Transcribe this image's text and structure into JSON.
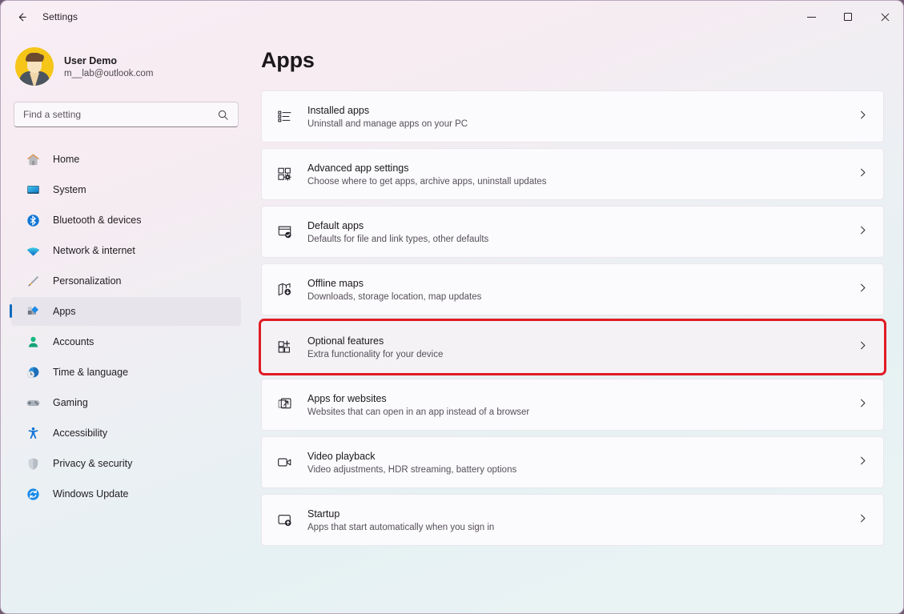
{
  "window": {
    "title": "Settings",
    "back_icon": "back-arrow-icon",
    "controls": {
      "minimize": "minimize-icon",
      "maximize": "maximize-icon",
      "close": "close-icon"
    }
  },
  "sidebar": {
    "profile": {
      "name": "User Demo",
      "email": "m__lab@outlook.com",
      "avatar_icon": "user-avatar"
    },
    "search": {
      "placeholder": "Find a setting",
      "value": "",
      "icon": "search-icon"
    },
    "items": [
      {
        "label": "Home",
        "icon": "home-icon",
        "selected": false
      },
      {
        "label": "System",
        "icon": "system-icon",
        "selected": false
      },
      {
        "label": "Bluetooth & devices",
        "icon": "bluetooth-icon",
        "selected": false
      },
      {
        "label": "Network & internet",
        "icon": "wifi-icon",
        "selected": false
      },
      {
        "label": "Personalization",
        "icon": "brush-icon",
        "selected": false
      },
      {
        "label": "Apps",
        "icon": "apps-icon",
        "selected": true
      },
      {
        "label": "Accounts",
        "icon": "account-icon",
        "selected": false
      },
      {
        "label": "Time & language",
        "icon": "clock-globe-icon",
        "selected": false
      },
      {
        "label": "Gaming",
        "icon": "gamepad-icon",
        "selected": false
      },
      {
        "label": "Accessibility",
        "icon": "accessibility-icon",
        "selected": false
      },
      {
        "label": "Privacy & security",
        "icon": "shield-icon",
        "selected": false
      },
      {
        "label": "Windows Update",
        "icon": "update-icon",
        "selected": false
      }
    ]
  },
  "main": {
    "page_title": "Apps",
    "cards": [
      {
        "title": "Installed apps",
        "subtitle": "Uninstall and manage apps on your PC",
        "icon": "list-icon",
        "highlighted": false
      },
      {
        "title": "Advanced app settings",
        "subtitle": "Choose where to get apps, archive apps, uninstall updates",
        "icon": "app-settings-icon",
        "highlighted": false
      },
      {
        "title": "Default apps",
        "subtitle": "Defaults for file and link types, other defaults",
        "icon": "default-apps-icon",
        "highlighted": false
      },
      {
        "title": "Offline maps",
        "subtitle": "Downloads, storage location, map updates",
        "icon": "map-download-icon",
        "highlighted": false
      },
      {
        "title": "Optional features",
        "subtitle": "Extra functionality for your device",
        "icon": "optional-features-icon",
        "highlighted": true
      },
      {
        "title": "Apps for websites",
        "subtitle": "Websites that can open in an app instead of a browser",
        "icon": "external-link-icon",
        "highlighted": false
      },
      {
        "title": "Video playback",
        "subtitle": "Video adjustments, HDR streaming, battery options",
        "icon": "video-icon",
        "highlighted": false
      },
      {
        "title": "Startup",
        "subtitle": "Apps that start automatically when you sign in",
        "icon": "startup-icon",
        "highlighted": false
      }
    ],
    "chevron_icon": "chevron-right-icon"
  },
  "colors": {
    "accent": "#0f6cbd",
    "highlight": "#e01b24",
    "card_bg": "#fbfafc",
    "selected_nav": "#e7e4eb"
  }
}
